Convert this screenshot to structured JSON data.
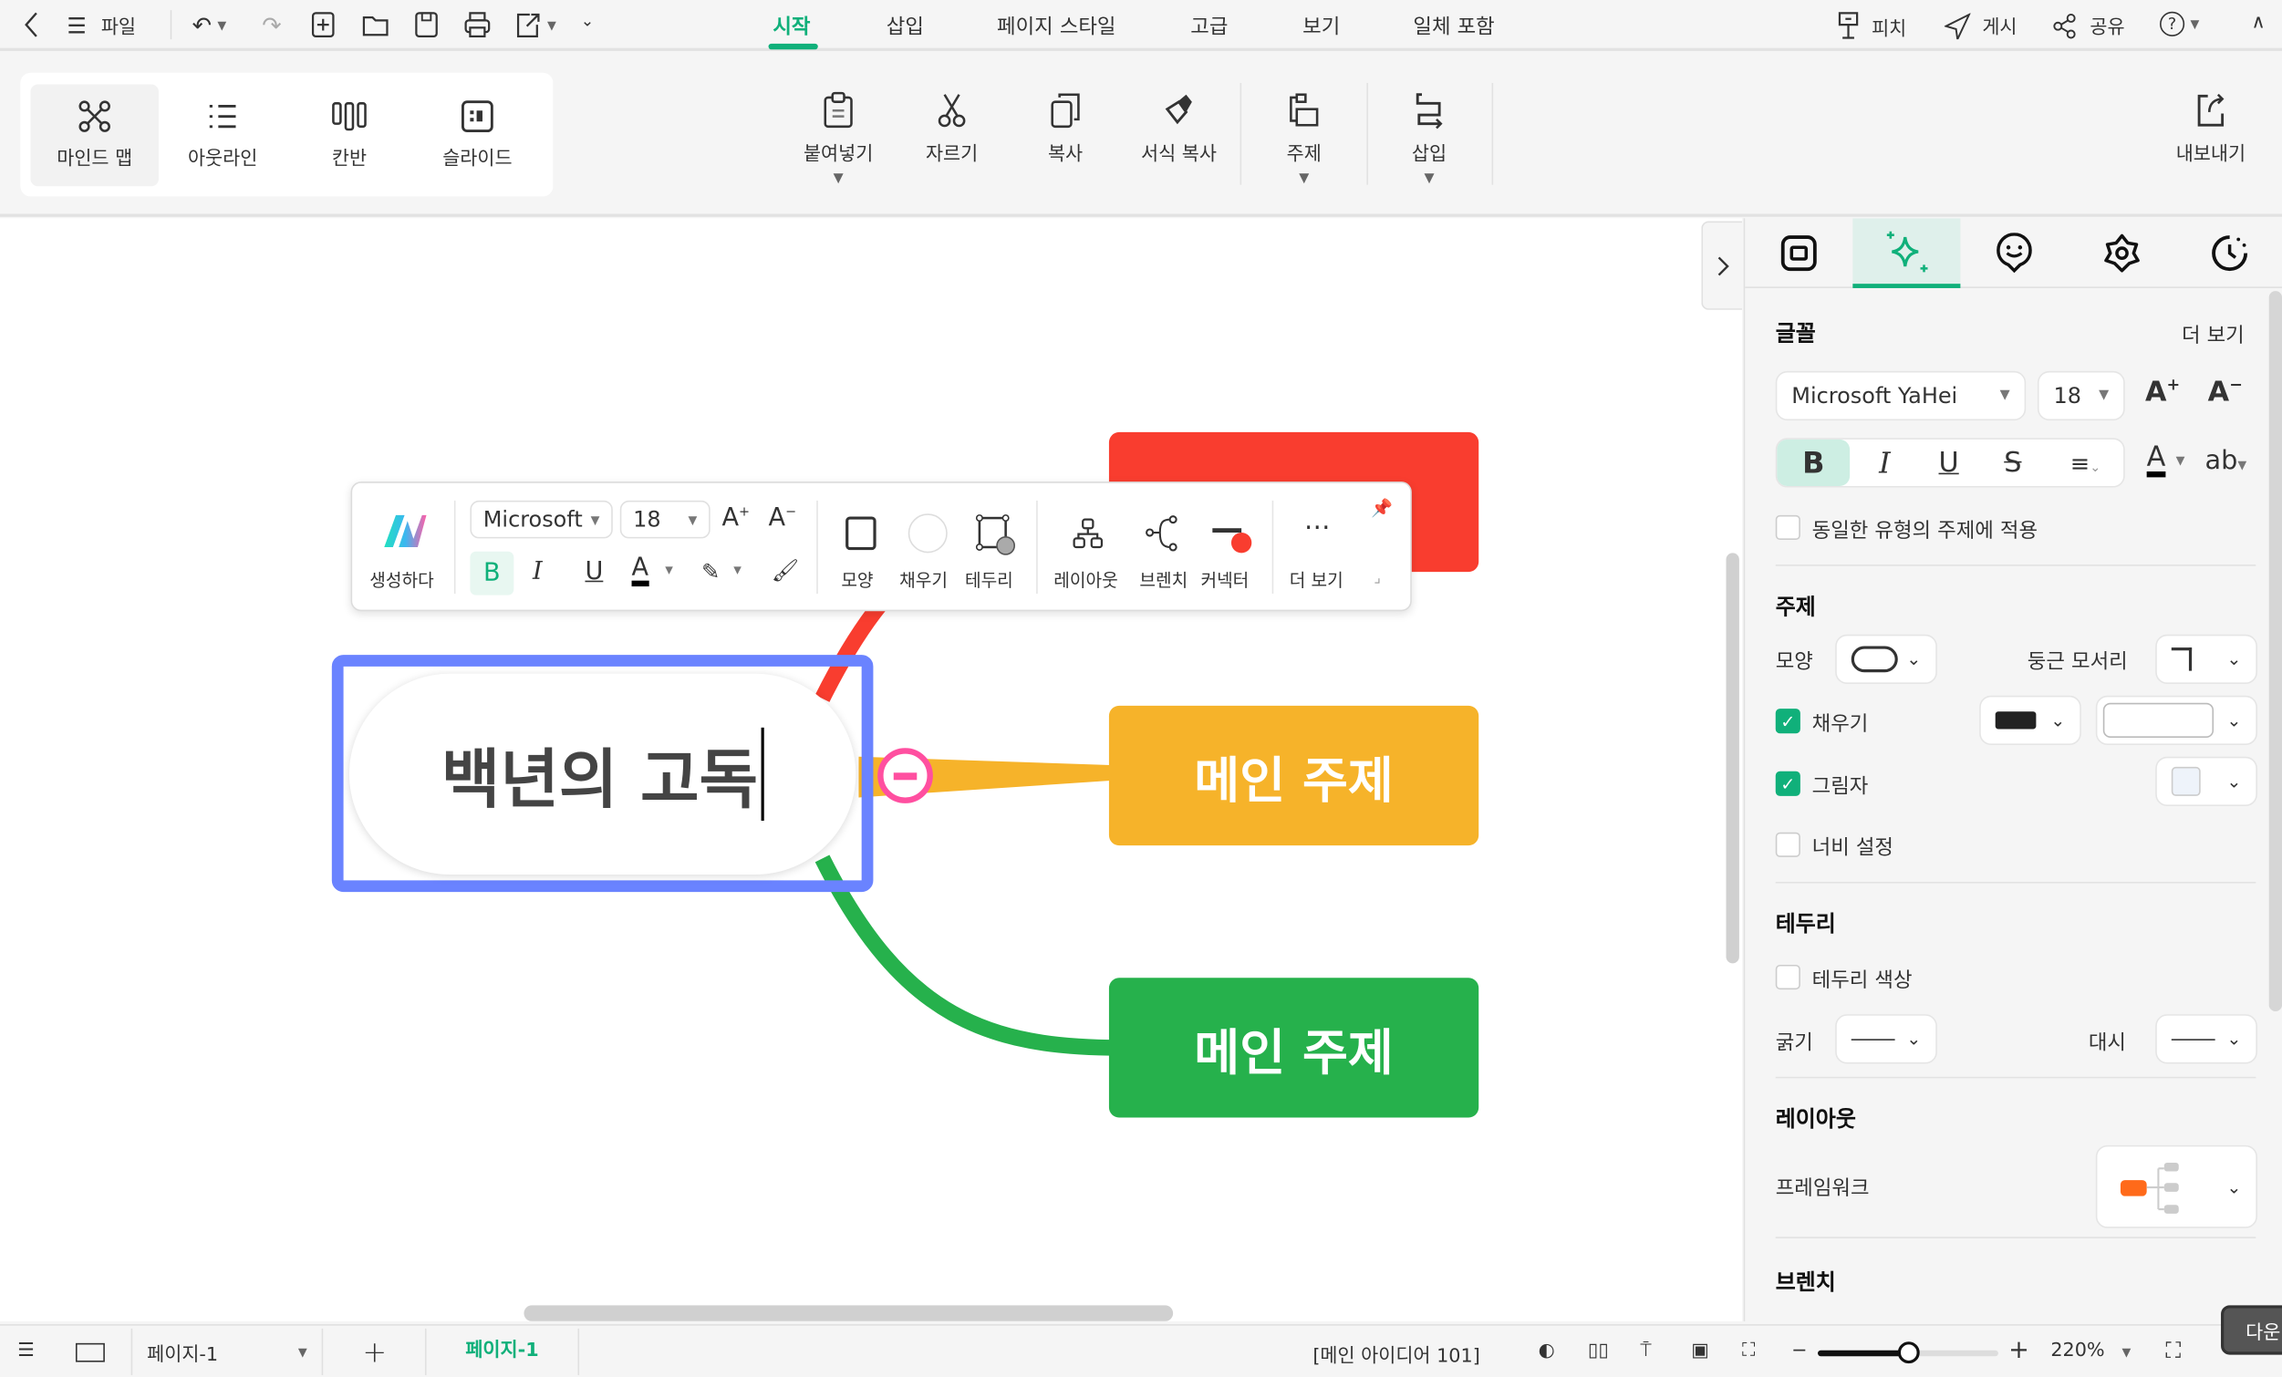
{
  "topbar": {
    "file_label": "파일",
    "tabs": [
      {
        "label": "시작",
        "active": true
      },
      {
        "label": "삽입"
      },
      {
        "label": "페이지 스타일"
      },
      {
        "label": "고급"
      },
      {
        "label": "보기"
      },
      {
        "label": "일체 포함"
      }
    ],
    "right": {
      "pitch": "피치",
      "publish": "게시",
      "share": "공유"
    }
  },
  "ribbon": {
    "views": [
      {
        "label": "마인드 맵",
        "icon": "mindmap-icon",
        "selected": true
      },
      {
        "label": "아웃라인",
        "icon": "outline-icon"
      },
      {
        "label": "칸반",
        "icon": "kanban-icon"
      },
      {
        "label": "슬라이드",
        "icon": "slide-icon"
      }
    ],
    "paste": "붙여넣기",
    "cut": "자르기",
    "copy": "복사",
    "format_painter": "서식 복사",
    "topic": "주제",
    "insert": "삽입",
    "export": "내보내기"
  },
  "canvas": {
    "central_topic": "백년의 고독",
    "main_topics": [
      {
        "label": "메인 주제",
        "color": "#f93d2f"
      },
      {
        "label": "메인 주제",
        "color": "#f6b32a"
      },
      {
        "label": "메인 주제",
        "color": "#26b14c"
      }
    ],
    "selection_color": "#6a83ff",
    "collapse_color": "#ff4fa0"
  },
  "floating_toolbar": {
    "generate": "생성하다",
    "font": "Microsoft",
    "size": "18",
    "shape": "모양",
    "fill": "채우기",
    "border": "테두리",
    "layout": "레이아웃",
    "branch": "브렌치",
    "connector": "커넥터",
    "more": "더 보기"
  },
  "panel": {
    "font_section": {
      "title": "글꼴",
      "more": "더 보기",
      "font": "Microsoft YaHei",
      "size": "18",
      "bold_active": true,
      "apply_same": "동일한 유형의 주제에 적용",
      "apply_same_checked": false
    },
    "topic_section": {
      "title": "주제",
      "shape_label": "모양",
      "corner_label": "둥근 모서리",
      "fill_label": "채우기",
      "fill_checked": true,
      "fill_color": "#222222",
      "shadow_label": "그림자",
      "shadow_checked": true,
      "width_label": "너비 설정",
      "width_checked": false
    },
    "border_section": {
      "title": "테두리",
      "color_label": "테두리 색상",
      "color_checked": false,
      "weight_label": "굵기",
      "dash_label": "대시"
    },
    "layout_section": {
      "title": "레이아웃",
      "framework_label": "프레임워크"
    },
    "branch_section": {
      "title": "브렌치"
    }
  },
  "bottombar": {
    "page_select": "페이지-1",
    "page_tab": "페이지-1",
    "status": "[메인 아이디어 101]",
    "zoom": "220%",
    "zoom_fraction": 0.5,
    "tooltip": "다운"
  }
}
